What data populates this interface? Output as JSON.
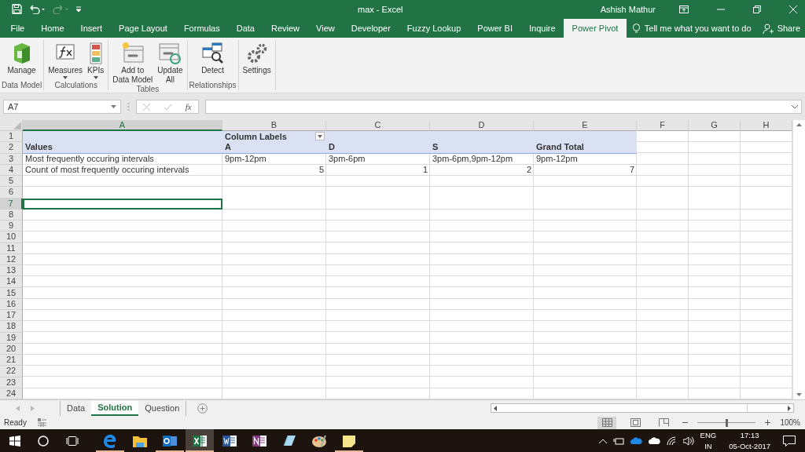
{
  "window": {
    "title": "max  -  Excel",
    "user": "Ashish Mathur"
  },
  "quick_access": [
    {
      "kind": "save",
      "disabled": false
    },
    {
      "kind": "undo",
      "disabled": false
    },
    {
      "kind": "redo",
      "disabled": true
    }
  ],
  "ribbon_tabs": [
    {
      "label": "File",
      "selected": false
    },
    {
      "label": "Home",
      "selected": false
    },
    {
      "label": "Insert",
      "selected": false
    },
    {
      "label": "Page Layout",
      "selected": false
    },
    {
      "label": "Formulas",
      "selected": false
    },
    {
      "label": "Data",
      "selected": false
    },
    {
      "label": "Review",
      "selected": false
    },
    {
      "label": "View",
      "selected": false
    },
    {
      "label": "Developer",
      "selected": false
    },
    {
      "label": "Fuzzy Lookup",
      "selected": false
    },
    {
      "label": "Power BI",
      "selected": false
    },
    {
      "label": "Inquire",
      "selected": false
    },
    {
      "label": "Power Pivot",
      "selected": true
    }
  ],
  "tell_me": "Tell me what you want to do",
  "share": "Share",
  "ribbon_groups": [
    {
      "label": "Data Model",
      "buttons": [
        {
          "kind": "manage",
          "label": [
            "Manage"
          ],
          "dropdown": false
        }
      ]
    },
    {
      "label": "Calculations",
      "buttons": [
        {
          "kind": "measures",
          "label": [
            "Measures"
          ],
          "dropdown": true
        },
        {
          "kind": "kpis",
          "label": [
            "KPIs"
          ],
          "dropdown": true
        }
      ]
    },
    {
      "label": "Tables",
      "buttons": [
        {
          "kind": "add",
          "label": [
            "Add to",
            "Data Model"
          ],
          "dropdown": false
        },
        {
          "kind": "update",
          "label": [
            "Update",
            "All"
          ],
          "dropdown": false
        }
      ]
    },
    {
      "label": "Relationships",
      "buttons": [
        {
          "kind": "detect",
          "label": [
            "Detect"
          ],
          "dropdown": false
        }
      ]
    },
    {
      "buttons": [
        {
          "kind": "settings",
          "label": [
            "Settings"
          ],
          "dropdown": false
        }
      ]
    }
  ],
  "formula_bar": {
    "name_box": "A7",
    "fx": "fx"
  },
  "sheet": {
    "columns": [
      {
        "label": "A",
        "selected": true
      },
      {
        "label": "B",
        "selected": false
      },
      {
        "label": "C",
        "selected": false
      },
      {
        "label": "D",
        "selected": false
      },
      {
        "label": "E",
        "selected": false
      },
      {
        "label": "F",
        "selected": false
      },
      {
        "label": "G",
        "selected": false
      },
      {
        "label": "H",
        "selected": false
      }
    ],
    "rows": [
      {
        "label": "1",
        "selected": false
      },
      {
        "label": "2",
        "selected": false
      },
      {
        "label": "3",
        "selected": false
      },
      {
        "label": "4",
        "selected": false
      },
      {
        "label": "5",
        "selected": false
      },
      {
        "label": "6",
        "selected": false
      },
      {
        "label": "7",
        "selected": true
      },
      {
        "label": "8",
        "selected": false
      },
      {
        "label": "9",
        "selected": false
      },
      {
        "label": "10",
        "selected": false
      },
      {
        "label": "11",
        "selected": false
      },
      {
        "label": "12",
        "selected": false
      },
      {
        "label": "13",
        "selected": false
      },
      {
        "label": "14",
        "selected": false
      },
      {
        "label": "15",
        "selected": false
      },
      {
        "label": "16",
        "selected": false
      },
      {
        "label": "17",
        "selected": false
      },
      {
        "label": "18",
        "selected": false
      },
      {
        "label": "19",
        "selected": false
      },
      {
        "label": "20",
        "selected": false
      },
      {
        "label": "21",
        "selected": false
      },
      {
        "label": "22",
        "selected": false
      },
      {
        "label": "23",
        "selected": false
      },
      {
        "label": "24",
        "selected": false
      }
    ],
    "pivot": {
      "column_labels": "Column Labels",
      "values_label": "Values",
      "column_headers": [
        "A",
        "D",
        "S",
        "Grand Total"
      ],
      "rows": [
        {
          "label": "Most frequently occuring intervals",
          "kind": "text",
          "values": [
            "9pm-12pm",
            "3pm-6pm",
            "3pm-6pm,9pm-12pm",
            "9pm-12pm"
          ]
        },
        {
          "label": "Count of most frequently occuring intervals",
          "kind": "number",
          "values": [
            "5",
            "1",
            "2",
            "7"
          ]
        }
      ]
    }
  },
  "sheet_tabs": [
    {
      "label": "Data",
      "selected": false
    },
    {
      "label": "Solution",
      "selected": true
    },
    {
      "label": "Question",
      "selected": false
    }
  ],
  "status_bar": {
    "text": "Ready",
    "views": [
      {
        "kind": "normal",
        "selected": true
      },
      {
        "kind": "page_layout",
        "selected": false
      },
      {
        "kind": "page_break",
        "selected": false
      }
    ],
    "zoom_slider": {
      "level": 0.5
    },
    "zoom": "100%"
  },
  "taskbar": {
    "apps": [
      {
        "kind": "edge",
        "running": true,
        "selected": false
      },
      {
        "kind": "explorer",
        "running": false,
        "selected": false
      },
      {
        "kind": "outlook",
        "running": true,
        "selected": false
      },
      {
        "kind": "excel",
        "running": true,
        "selected": true
      },
      {
        "kind": "word",
        "running": false,
        "selected": false
      },
      {
        "kind": "onenote",
        "running": false,
        "selected": false
      },
      {
        "kind": "snip",
        "running": false,
        "selected": false
      },
      {
        "kind": "paint",
        "running": false,
        "selected": false
      },
      {
        "kind": "sticky",
        "running": true,
        "selected": false
      }
    ],
    "language": [
      "ENG",
      "IN"
    ],
    "time": "17:13",
    "date": "05-Oct-2017"
  }
}
